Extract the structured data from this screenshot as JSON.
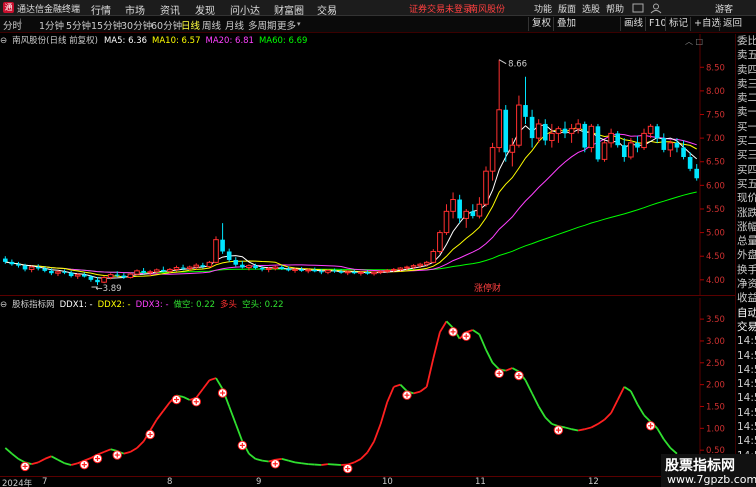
{
  "titlebar": {
    "app_title": "通达信金融终端",
    "menus": [
      "行情",
      "市场",
      "资讯",
      "发现",
      "问小达",
      "财富圈",
      "交易"
    ],
    "alert": "证券交易未登录",
    "stock": "南风股份",
    "right_menus": [
      "功能",
      "版面",
      "选股",
      "帮助"
    ],
    "user": "游客"
  },
  "toolbar": {
    "periods": [
      "分时",
      "1分钟",
      "5分钟",
      "15分钟",
      "30分钟",
      "60分钟",
      "日线",
      "周线",
      "月线",
      "多周期",
      "更多"
    ],
    "active_period": "日线",
    "right_buttons": [
      "复权",
      "叠加",
      "画线",
      "F10",
      "标记",
      "+自选",
      "返回"
    ]
  },
  "ma_legend": {
    "name": "南风股份(日线 前复权)",
    "ma5": "MA5: 6.36",
    "ma10": "MA10: 6.57",
    "ma20": "MA20: 6.81",
    "ma60": "MA60: 6.69",
    "ma5_color": "#ffffff",
    "ma10_color": "#ffff00",
    "ma20_color": "#ff40ff",
    "ma60_color": "#00ff00"
  },
  "price_axis": [
    "8.50",
    "8.00",
    "7.50",
    "7.00",
    "6.50",
    "6.00",
    "5.50",
    "5.00",
    "4.50",
    "4.00"
  ],
  "annotations": {
    "high": "8.66",
    "low": "3.89",
    "event": "涨停财"
  },
  "indicator_legend": {
    "name": "股标指标网",
    "ddx1": "DDX1: -",
    "ddx2": "DDX2: -",
    "ddx3": "DDX3: -",
    "duokong": "做空: 0.22",
    "duotou": "多头",
    "kongtou": "空头: 0.22"
  },
  "indicator_axis": [
    "3.50",
    "3.00",
    "2.50",
    "2.00",
    "1.50",
    "1.00",
    "0.50"
  ],
  "right_panel": [
    "委比",
    "卖五",
    "卖四",
    "卖三",
    "卖二",
    "卖一",
    "买一",
    "买二",
    "买三",
    "买四",
    "买五",
    "现价",
    "涨跌",
    "涨幅",
    "总量",
    "外盘",
    "换手",
    "净资",
    "收益",
    "自动",
    "交易",
    "14:50",
    "14:50",
    "14:50",
    "14:50",
    "14:50",
    "14:50",
    "14:50",
    "14:50",
    "14:50",
    "14:50",
    "14:50"
  ],
  "dates": {
    "year": "2024年",
    "months": [
      "7",
      "8",
      "9",
      "10",
      "11",
      "12"
    ]
  },
  "watermark": {
    "title": "股票指标网",
    "url": "www.7gpzb.com"
  },
  "colors": {
    "up": "#ff3030",
    "down": "#00e5ff",
    "ind_up": "#ff2020",
    "ind_down": "#30e030",
    "axis": "#5a0000"
  },
  "chart_data": {
    "type": "candlestick",
    "ohlc_daily": [
      [
        4.45,
        4.5,
        4.34,
        4.38
      ],
      [
        4.38,
        4.43,
        4.3,
        4.33
      ],
      [
        4.33,
        4.38,
        4.26,
        4.3
      ],
      [
        4.3,
        4.34,
        4.18,
        4.22
      ],
      [
        4.22,
        4.3,
        4.16,
        4.27
      ],
      [
        4.27,
        4.33,
        4.2,
        4.24
      ],
      [
        4.24,
        4.28,
        4.16,
        4.19
      ],
      [
        4.19,
        4.24,
        4.1,
        4.14
      ],
      [
        4.14,
        4.2,
        4.08,
        4.17
      ],
      [
        4.17,
        4.22,
        4.12,
        4.15
      ],
      [
        4.15,
        4.19,
        4.05,
        4.08
      ],
      [
        4.08,
        4.14,
        4.02,
        4.11
      ],
      [
        4.11,
        4.16,
        4.05,
        4.07
      ],
      [
        4.07,
        4.1,
        3.96,
        4.0
      ],
      [
        4.0,
        4.06,
        3.89,
        3.95
      ],
      [
        3.95,
        4.08,
        3.93,
        4.05
      ],
      [
        4.05,
        4.14,
        4.01,
        4.11
      ],
      [
        4.11,
        4.18,
        4.06,
        4.09
      ],
      [
        4.09,
        4.14,
        4.02,
        4.05
      ],
      [
        4.05,
        4.15,
        4.03,
        4.12
      ],
      [
        4.12,
        4.22,
        4.1,
        4.19
      ],
      [
        4.19,
        4.25,
        4.12,
        4.15
      ],
      [
        4.15,
        4.21,
        4.08,
        4.17
      ],
      [
        4.17,
        4.24,
        4.13,
        4.21
      ],
      [
        4.21,
        4.28,
        4.16,
        4.18
      ],
      [
        4.18,
        4.25,
        4.14,
        4.22
      ],
      [
        4.22,
        4.3,
        4.18,
        4.26
      ],
      [
        4.26,
        4.32,
        4.2,
        4.24
      ],
      [
        4.24,
        4.3,
        4.19,
        4.27
      ],
      [
        4.27,
        4.35,
        4.22,
        4.31
      ],
      [
        4.31,
        4.36,
        4.24,
        4.28
      ],
      [
        4.28,
        4.4,
        4.26,
        4.37
      ],
      [
        4.37,
        4.92,
        4.35,
        4.85
      ],
      [
        4.85,
        5.2,
        4.55,
        4.6
      ],
      [
        4.6,
        4.66,
        4.38,
        4.42
      ],
      [
        4.42,
        4.48,
        4.28,
        4.32
      ],
      [
        4.32,
        4.4,
        4.24,
        4.26
      ],
      [
        4.26,
        4.33,
        4.2,
        4.3
      ],
      [
        4.3,
        4.34,
        4.22,
        4.25
      ],
      [
        4.25,
        4.29,
        4.18,
        4.22
      ],
      [
        4.22,
        4.27,
        4.16,
        4.24
      ],
      [
        4.24,
        4.3,
        4.2,
        4.27
      ],
      [
        4.27,
        4.31,
        4.21,
        4.23
      ],
      [
        4.23,
        4.28,
        4.18,
        4.2
      ],
      [
        4.2,
        4.25,
        4.15,
        4.22
      ],
      [
        4.22,
        4.27,
        4.17,
        4.19
      ],
      [
        4.19,
        4.24,
        4.14,
        4.21
      ],
      [
        4.21,
        4.26,
        4.16,
        4.18
      ],
      [
        4.18,
        4.23,
        4.12,
        4.16
      ],
      [
        4.16,
        4.22,
        4.12,
        4.2
      ],
      [
        4.2,
        4.24,
        4.15,
        4.18
      ],
      [
        4.18,
        4.22,
        4.13,
        4.15
      ],
      [
        4.15,
        4.2,
        4.1,
        4.17
      ],
      [
        4.17,
        4.21,
        4.12,
        4.14
      ],
      [
        4.14,
        4.19,
        4.09,
        4.16
      ],
      [
        4.16,
        4.2,
        4.11,
        4.13
      ],
      [
        4.13,
        4.18,
        4.09,
        4.16
      ],
      [
        4.16,
        4.2,
        4.12,
        4.18
      ],
      [
        4.18,
        4.23,
        4.14,
        4.2
      ],
      [
        4.2,
        4.25,
        4.16,
        4.22
      ],
      [
        4.22,
        4.27,
        4.18,
        4.25
      ],
      [
        4.25,
        4.3,
        4.2,
        4.27
      ],
      [
        4.27,
        4.33,
        4.22,
        4.3
      ],
      [
        4.3,
        4.36,
        4.25,
        4.33
      ],
      [
        4.33,
        4.4,
        4.28,
        4.37
      ],
      [
        4.37,
        4.65,
        4.35,
        4.6
      ],
      [
        4.6,
        5.05,
        4.55,
        5.0
      ],
      [
        5.0,
        5.6,
        4.95,
        5.45
      ],
      [
        5.45,
        5.85,
        5.3,
        5.7
      ],
      [
        5.7,
        5.8,
        5.2,
        5.3
      ],
      [
        5.3,
        5.5,
        5.1,
        5.45
      ],
      [
        5.45,
        5.6,
        5.3,
        5.35
      ],
      [
        5.35,
        5.75,
        5.3,
        5.6
      ],
      [
        5.6,
        6.4,
        5.55,
        6.3
      ],
      [
        6.3,
        6.9,
        6.1,
        6.8
      ],
      [
        6.8,
        8.66,
        6.7,
        7.6
      ],
      [
        7.6,
        7.7,
        6.5,
        6.7
      ],
      [
        6.7,
        7.0,
        6.4,
        6.85
      ],
      [
        6.85,
        7.9,
        6.8,
        7.7
      ],
      [
        7.7,
        8.3,
        7.3,
        7.45
      ],
      [
        7.45,
        7.6,
        6.8,
        7.0
      ],
      [
        7.0,
        7.4,
        6.9,
        7.3
      ],
      [
        7.3,
        7.4,
        6.85,
        6.95
      ],
      [
        6.95,
        7.3,
        6.8,
        7.1
      ],
      [
        7.1,
        7.25,
        6.9,
        7.2
      ],
      [
        7.2,
        7.35,
        7.0,
        7.1
      ],
      [
        7.1,
        7.3,
        6.9,
        7.2
      ],
      [
        7.2,
        7.4,
        7.1,
        7.3
      ],
      [
        7.3,
        7.35,
        6.7,
        6.8
      ],
      [
        6.8,
        7.3,
        6.7,
        7.25
      ],
      [
        7.25,
        7.3,
        6.5,
        6.55
      ],
      [
        6.55,
        6.95,
        6.5,
        6.9
      ],
      [
        6.9,
        7.2,
        6.8,
        7.1
      ],
      [
        7.1,
        7.15,
        6.8,
        6.85
      ],
      [
        6.85,
        7.0,
        6.5,
        6.6
      ],
      [
        6.6,
        7.0,
        6.55,
        6.9
      ],
      [
        6.9,
        7.05,
        6.7,
        6.8
      ],
      [
        6.8,
        7.2,
        6.75,
        7.1
      ],
      [
        7.1,
        7.3,
        7.0,
        7.25
      ],
      [
        7.25,
        7.3,
        6.9,
        7.0
      ],
      [
        7.0,
        7.1,
        6.7,
        6.75
      ],
      [
        6.75,
        6.95,
        6.6,
        6.9
      ],
      [
        6.9,
        7.0,
        6.7,
        6.8
      ],
      [
        6.8,
        6.95,
        6.55,
        6.6
      ],
      [
        6.6,
        6.7,
        6.3,
        6.35
      ],
      [
        6.35,
        6.45,
        6.1,
        6.15
      ]
    ],
    "price_range": [
      3.7,
      8.95
    ],
    "indicator_range": [
      0,
      3.8
    ],
    "indicator_values": [
      0.55,
      0.42,
      0.3,
      0.22,
      0.18,
      0.22,
      0.3,
      0.36,
      0.28,
      0.2,
      0.16,
      0.2,
      0.26,
      0.32,
      0.4,
      0.46,
      0.52,
      0.48,
      0.42,
      0.46,
      0.55,
      0.7,
      0.95,
      1.2,
      1.4,
      1.6,
      1.75,
      1.72,
      1.65,
      1.7,
      1.9,
      2.1,
      2.15,
      1.9,
      1.5,
      1.1,
      0.7,
      0.42,
      0.3,
      0.26,
      0.24,
      0.28,
      0.3,
      0.26,
      0.22,
      0.2,
      0.18,
      0.17,
      0.16,
      0.18,
      0.17,
      0.16,
      0.17,
      0.22,
      0.3,
      0.45,
      0.7,
      1.1,
      1.6,
      1.95,
      2.0,
      1.85,
      1.8,
      1.84,
      1.95,
      2.6,
      3.2,
      3.45,
      3.3,
      3.05,
      3.2,
      3.25,
      3.15,
      2.8,
      2.5,
      2.35,
      2.32,
      2.38,
      2.3,
      2.1,
      1.8,
      1.5,
      1.25,
      1.1,
      1.05,
      1.02,
      0.98,
      0.95,
      0.98,
      1.02,
      1.1,
      1.2,
      1.35,
      1.65,
      1.95,
      1.85,
      1.55,
      1.3,
      1.15,
      1.0,
      0.75,
      0.55,
      0.42
    ],
    "buy_markers": [
      3,
      12,
      14,
      17,
      22,
      26,
      29,
      33,
      36,
      41,
      52,
      61,
      68,
      70,
      75,
      78,
      84,
      98
    ]
  }
}
